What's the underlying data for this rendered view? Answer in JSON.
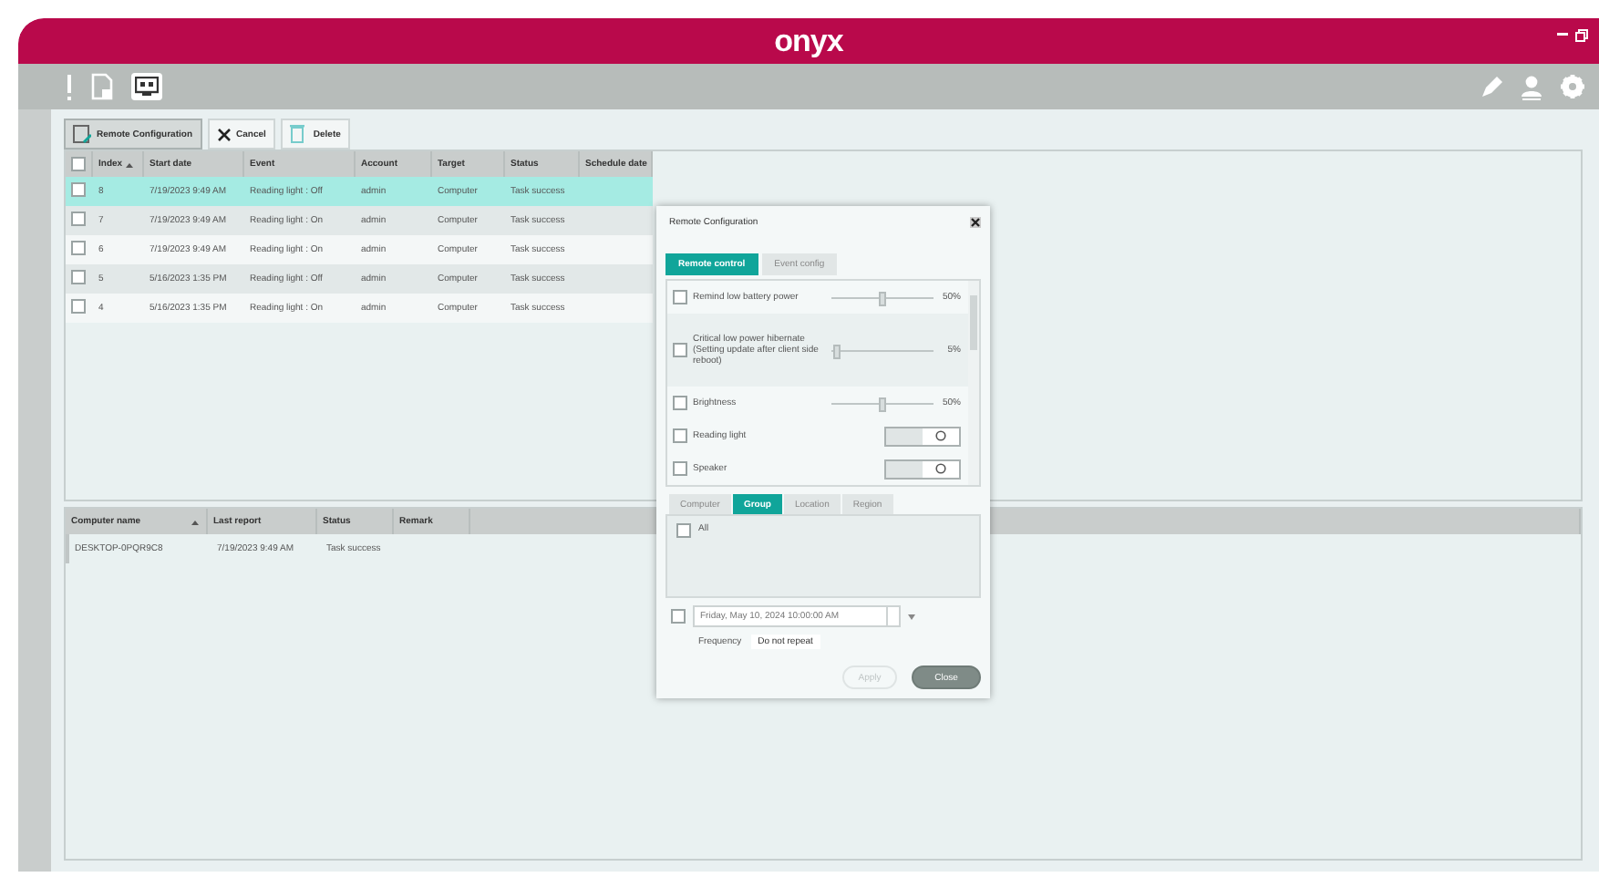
{
  "window": {
    "logo": "onyx"
  },
  "actions": [
    {
      "kind": "remote",
      "label": "Remote Configuration",
      "selected": true
    },
    {
      "kind": "cancel",
      "label": "Cancel",
      "selected": false
    },
    {
      "kind": "delete",
      "label": "Delete",
      "selected": false
    }
  ],
  "history_table": {
    "select_all": false,
    "columns": [
      "Index",
      "Start date",
      "Event",
      "Account",
      "Target",
      "Status",
      "Schedule date"
    ],
    "rows": [
      {
        "selected": true,
        "checked": false,
        "cells": [
          "8",
          "7/19/2023 9:49 AM",
          "Reading light : Off",
          "admin",
          "Computer",
          "Task success"
        ]
      },
      {
        "selected": false,
        "checked": false,
        "cells": [
          "7",
          "7/19/2023 9:49 AM",
          "Reading light : On",
          "admin",
          "Computer",
          "Task success"
        ]
      },
      {
        "selected": false,
        "checked": false,
        "cells": [
          "6",
          "7/19/2023 9:49 AM",
          "Reading light : On",
          "admin",
          "Computer",
          "Task success"
        ]
      },
      {
        "selected": false,
        "checked": false,
        "cells": [
          "5",
          "5/16/2023 1:35 PM",
          "Reading light : Off",
          "admin",
          "Computer",
          "Task success"
        ]
      },
      {
        "selected": false,
        "checked": false,
        "cells": [
          "4",
          "5/16/2023 1:35 PM",
          "Reading light : On",
          "admin",
          "Computer",
          "Task success"
        ]
      }
    ]
  },
  "computer_table": {
    "columns": [
      "Computer name",
      "Last report",
      "Status",
      "Remark"
    ],
    "rows": [
      {
        "cells": [
          "DESKTOP-0PQR9C8",
          "7/19/2023 9:49 AM",
          "Task success"
        ]
      }
    ]
  },
  "dialog": {
    "title": "Remote Configuration",
    "tabs": [
      {
        "label": "Remote control",
        "selected": true
      },
      {
        "label": "Event config",
        "selected": false
      }
    ],
    "settings": [
      {
        "kind": "slider",
        "label": "Remind low battery power",
        "checked": false,
        "level": 0.5,
        "reading": "50%"
      },
      {
        "kind": "slider",
        "label": "Critical low power hibernate (Setting update after client side reboot)",
        "checked": false,
        "level": 0.05,
        "reading": "5%"
      },
      {
        "kind": "slider",
        "label": "Brightness",
        "checked": false,
        "level": 0.5,
        "reading": "50%"
      },
      {
        "kind": "toggle",
        "label": "Reading light",
        "checked": false,
        "on": false
      },
      {
        "kind": "toggle",
        "label": "Speaker",
        "checked": false,
        "on": false
      }
    ],
    "target_tabs": [
      {
        "label": "Computer",
        "selected": false
      },
      {
        "label": "Group",
        "selected": true
      },
      {
        "label": "Location",
        "selected": false
      },
      {
        "label": "Region",
        "selected": false
      }
    ],
    "group_items": [
      {
        "label": "All",
        "checked": false
      }
    ],
    "schedule": {
      "checked": false,
      "value": "Friday, May 10, 2024 10:00:00 AM",
      "frequency_label": "Frequency",
      "frequency": "Do not repeat"
    },
    "buttons": [
      {
        "label": "Apply",
        "kind": "secondary",
        "disabled": true
      },
      {
        "label": "Close",
        "kind": "primary",
        "disabled": false
      }
    ]
  }
}
